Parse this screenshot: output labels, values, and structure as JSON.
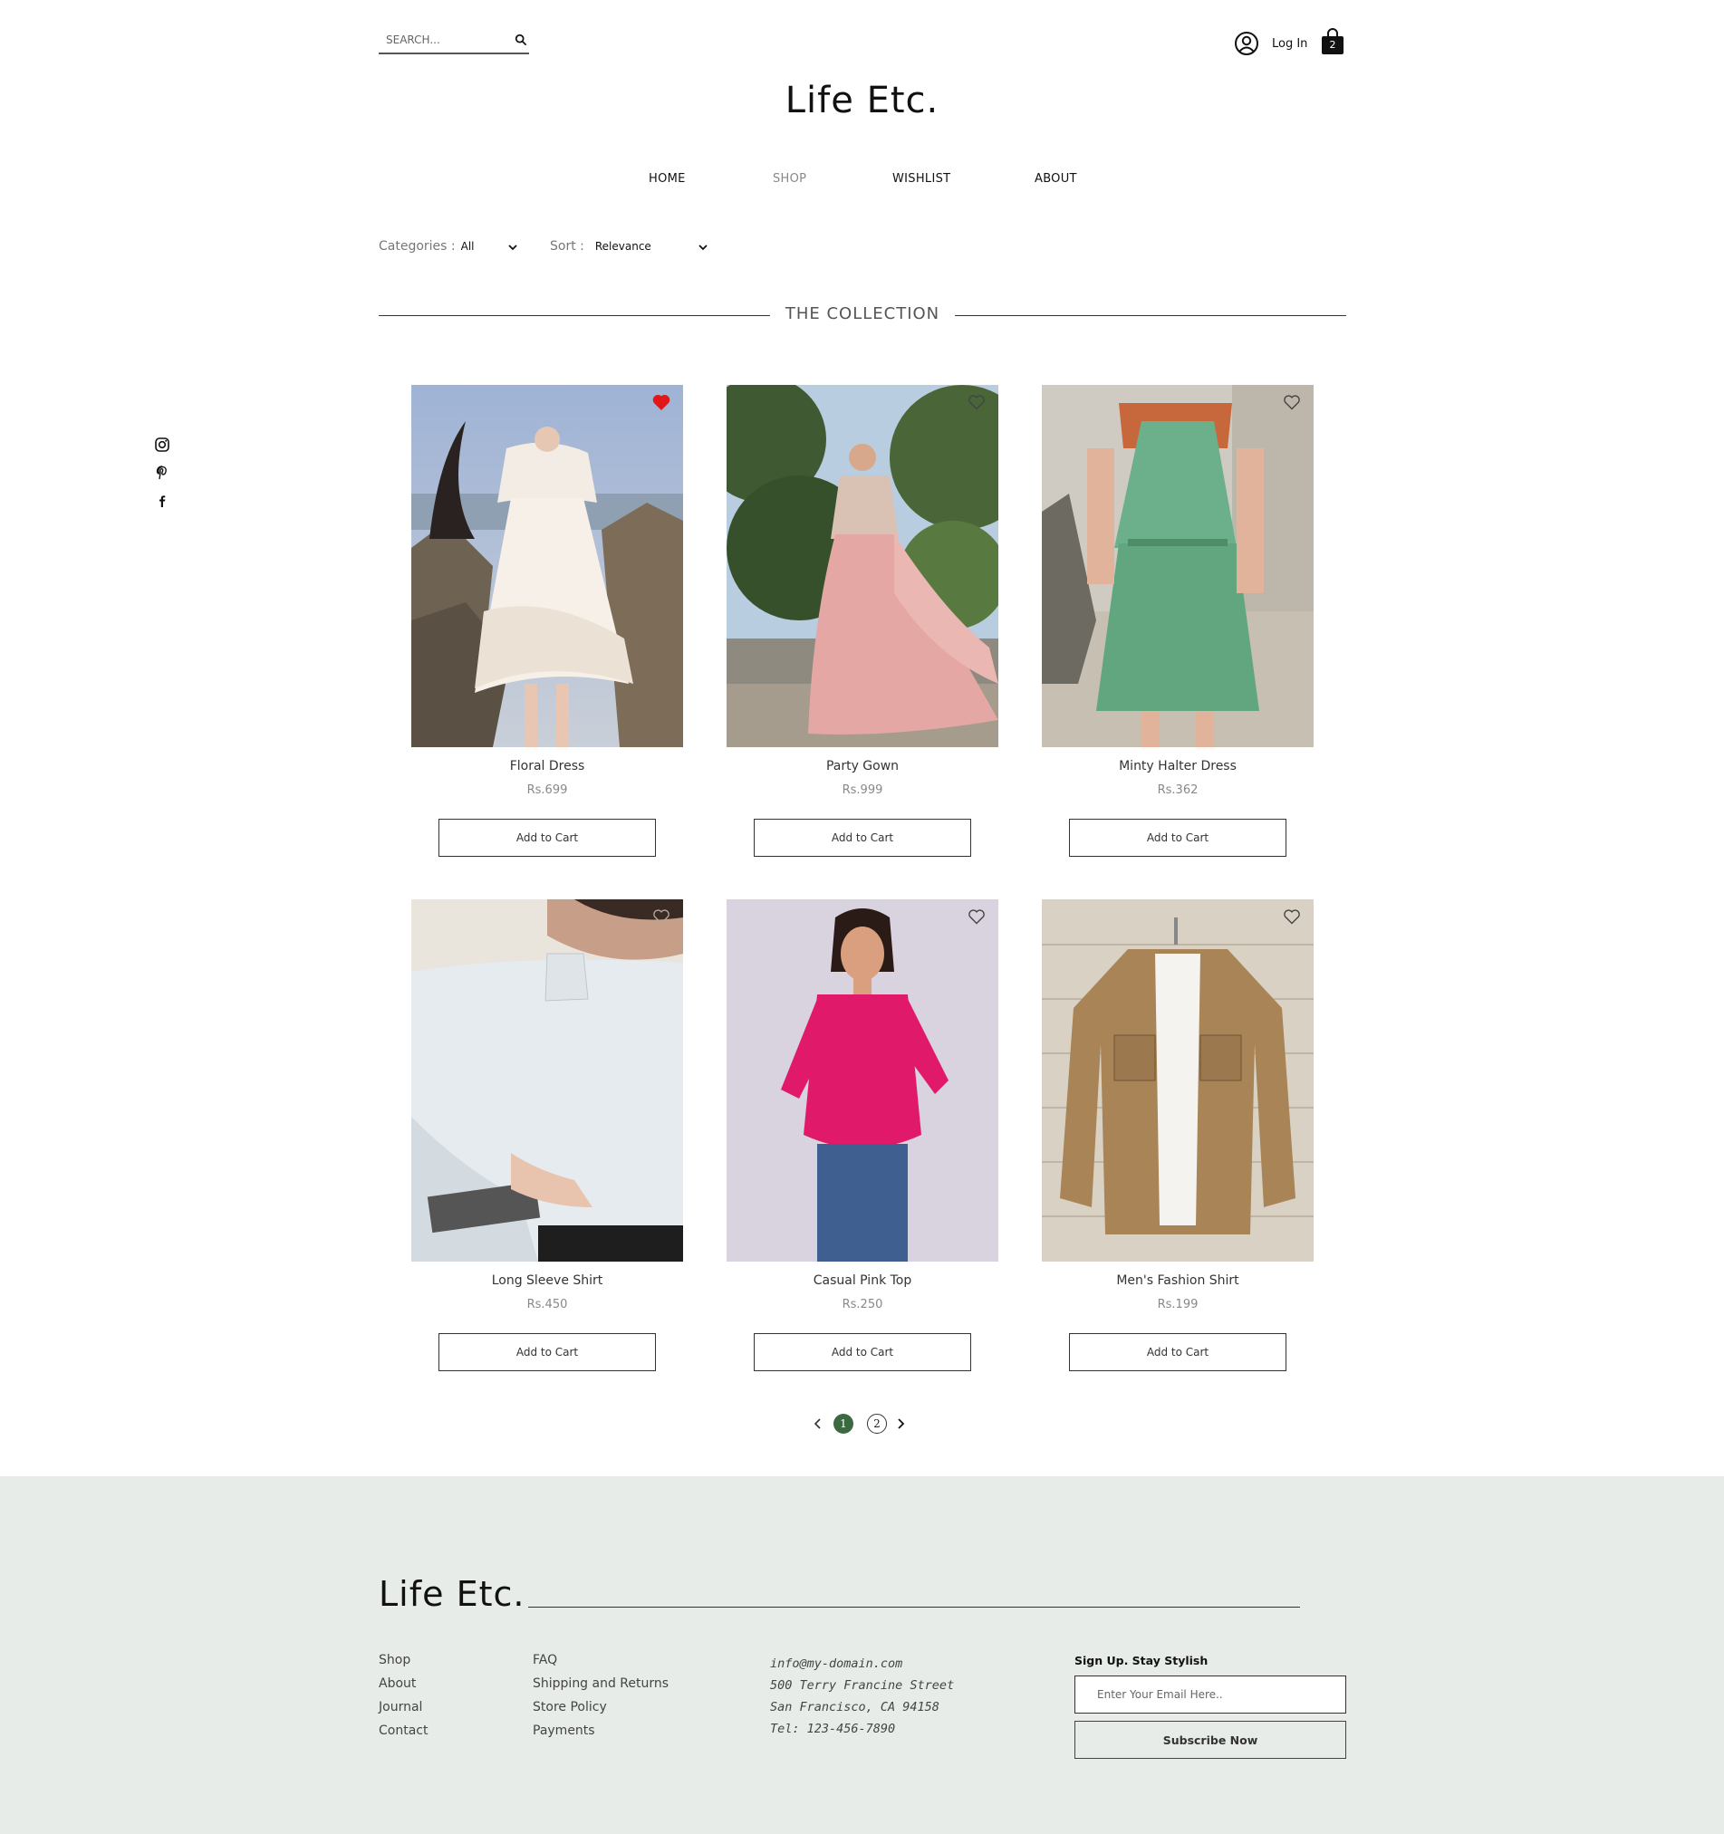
{
  "header": {
    "search_placeholder": "SEARCH...",
    "login_label": "Log In",
    "cart_count": "2"
  },
  "site": {
    "logo": "Life Etc."
  },
  "nav": {
    "items": [
      {
        "label": "HOME"
      },
      {
        "label": "SHOP"
      },
      {
        "label": "WISHLIST"
      },
      {
        "label": "ABOUT"
      }
    ],
    "active": "SHOP"
  },
  "filters": {
    "categories_label": "Categories :",
    "categories_value": "All",
    "sort_label": "Sort :",
    "sort_value": "Relevance"
  },
  "collection": {
    "title": "THE COLLECTION"
  },
  "products": [
    {
      "name": "Floral Dress",
      "price": "Rs.699",
      "button": "Add to Cart",
      "wishlisted": true
    },
    {
      "name": "Party Gown",
      "price": "Rs.999",
      "button": "Add to Cart",
      "wishlisted": false
    },
    {
      "name": "Minty Halter Dress",
      "price": "Rs.362",
      "button": "Add to Cart",
      "wishlisted": false
    },
    {
      "name": "Long Sleeve Shirt",
      "price": "Rs.450",
      "button": "Add to Cart",
      "wishlisted": false
    },
    {
      "name": "Casual Pink Top",
      "price": "Rs.250",
      "button": "Add to Cart",
      "wishlisted": false
    },
    {
      "name": "Men's Fashion Shirt",
      "price": "Rs.199",
      "button": "Add to Cart",
      "wishlisted": false
    }
  ],
  "pagination": {
    "pages": [
      "1",
      "2"
    ],
    "current": "1"
  },
  "social": {
    "icons": [
      "instagram-icon",
      "pinterest-icon",
      "facebook-icon"
    ]
  },
  "footer": {
    "logo": "Life Etc.",
    "links_col1": [
      "Shop",
      "About",
      "Journal",
      "Contact"
    ],
    "links_col2": [
      "FAQ",
      "Shipping and Returns",
      "Store Policy",
      "Payments"
    ],
    "contact": {
      "email": "info@my-domain.com",
      "address1": "500 Terry Francine Street",
      "address2": "San Francisco, CA 94158",
      "tel": "Tel: 123-456-7890"
    },
    "signup_title": "Sign Up. Stay Stylish",
    "email_placeholder": "Enter Your Email Here..",
    "subscribe_label": "Subscribe Now"
  },
  "colors": {
    "wishlist_active": "#e01818",
    "pager_current": "#3c6a40",
    "footer_bg": "#e8ece8"
  }
}
